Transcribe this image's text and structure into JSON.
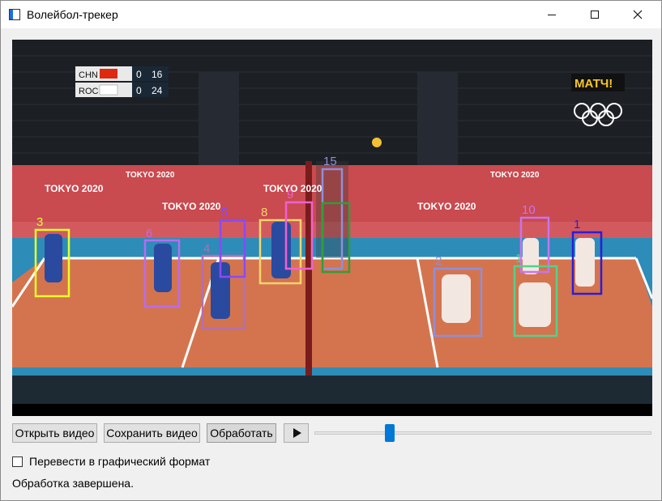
{
  "window": {
    "title": "Волейбол-трекер"
  },
  "scoreboard": {
    "rows": [
      {
        "team": "CHN",
        "sets": "0",
        "points": "16"
      },
      {
        "team": "ROC",
        "sets": "0",
        "points": "24"
      }
    ]
  },
  "broadcast_logo": "МАТЧ!",
  "court_banners": [
    "TOKYO 2020",
    "TOKYO 2020",
    "TOKYO 2020",
    "TOKYO 2020",
    "TOKYO 2020",
    "TOKYO 2020"
  ],
  "tracks": [
    {
      "id": "3",
      "color": "#e6ff2a"
    },
    {
      "id": "6",
      "color": "#b76cf0"
    },
    {
      "id": "4",
      "color": "#b46fb0"
    },
    {
      "id": "5",
      "color": "#8a4af5"
    },
    {
      "id": "8",
      "color": "#f5d56a"
    },
    {
      "id": "9",
      "color": "#f060d2"
    },
    {
      "id": "15",
      "color": "#8f8fd8"
    },
    {
      "id": "",
      "color": "#2f9e38"
    },
    {
      "id": "2",
      "color": "#8f8fd8"
    },
    {
      "id": "10",
      "color": "#c873f0"
    },
    {
      "id": "1",
      "color": "#55d08a"
    },
    {
      "id": "1",
      "color": "#2b1dd8"
    }
  ],
  "toolbar": {
    "open_label": "Открыть видео",
    "save_label": "Сохранить видео",
    "process_label": "Обработать",
    "play_icon": "play-icon"
  },
  "slider": {
    "position_fraction": 0.215
  },
  "checkbox": {
    "label": "Перевести в графический формат",
    "checked": false
  },
  "status": "Обработка завершена."
}
